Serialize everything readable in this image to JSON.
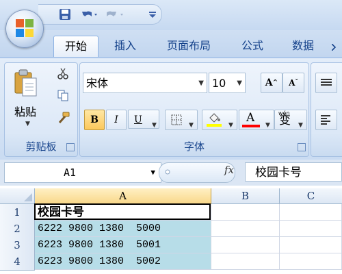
{
  "ribbon_tabs": [
    "开始",
    "插入",
    "页面布局",
    "公式",
    "数据"
  ],
  "clipboard": {
    "paste_label": "粘贴",
    "group_label": "剪贴板"
  },
  "font": {
    "name": "宋体",
    "size": "10",
    "group_label": "字体",
    "bold_label": "B",
    "italic_label": "I",
    "underline_label": "U",
    "grow_label": "A",
    "shrink_label": "A",
    "color_label": "A",
    "phonetic_label": "wén",
    "phonetic_char": "变",
    "highlight_color": "#ffff00",
    "font_color": "#ff0000"
  },
  "formula_bar": {
    "name_box": "A1",
    "fx": "fx",
    "content": "校园卡号"
  },
  "columns": [
    "A",
    "B",
    "C"
  ],
  "rows": [
    {
      "num": "1",
      "a": "校园卡号"
    },
    {
      "num": "2",
      "a": "6222 9800 1380  5000"
    },
    {
      "num": "3",
      "a": "6223 9800 1380  5001"
    },
    {
      "num": "4",
      "a": "6223 9800 1380  5002"
    }
  ],
  "colors": {
    "accent": "#15428b",
    "selection_fill": "#b7dde8"
  }
}
